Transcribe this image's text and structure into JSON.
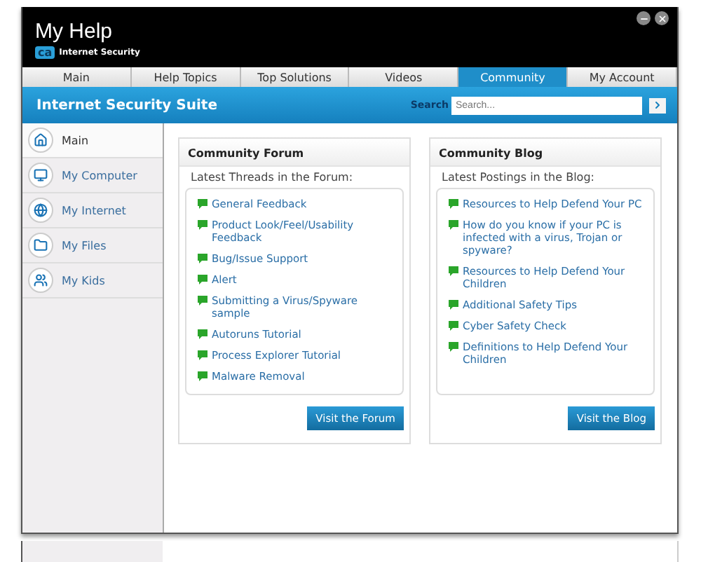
{
  "window": {
    "title": "My Help",
    "product": "Internet Security",
    "logo": "ca"
  },
  "tabs": [
    {
      "label": "Main",
      "selected": false
    },
    {
      "label": "Help Topics",
      "selected": false
    },
    {
      "label": "Top Solutions",
      "selected": false
    },
    {
      "label": "Videos",
      "selected": false
    },
    {
      "label": "Community",
      "selected": true
    },
    {
      "label": "My Account",
      "selected": false
    }
  ],
  "banner": {
    "title": "Internet Security Suite",
    "search_label": "Search",
    "search": {
      "placeholder": "Search..."
    }
  },
  "sidebar": {
    "items": [
      {
        "label": "Main",
        "selected": true
      },
      {
        "label": "My Computer",
        "selected": false
      },
      {
        "label": "My Internet",
        "selected": false
      },
      {
        "label": "My Files",
        "selected": false
      },
      {
        "label": "My Kids",
        "selected": false
      }
    ]
  },
  "panels": [
    {
      "title": "Community Forum",
      "subtitle": "Latest Threads in the Forum:",
      "links": [
        "General Feedback",
        "Product Look/Feel/Usability Feedback",
        "Bug/Issue Support",
        "Alert",
        "Submitting a Virus/Spyware sample",
        "Autoruns Tutorial",
        "Process Explorer Tutorial",
        "Malware Removal"
      ],
      "button": "Visit the Forum"
    },
    {
      "title": "Community Blog",
      "subtitle": "Latest Postings in the Blog:",
      "links": [
        "Resources to Help Defend Your PC",
        "How do you know if your PC is infected with a virus, Trojan or spyware?",
        "Resources to Help Defend Your Children",
        "Additional Safety Tips",
        "Cyber Safety Check",
        "Definitions to Help Defend Your Children"
      ],
      "button": "Visit the Blog"
    }
  ]
}
